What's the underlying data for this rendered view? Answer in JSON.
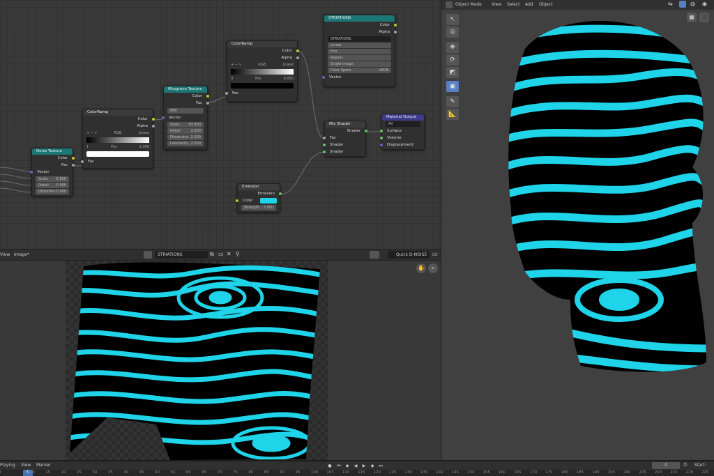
{
  "node_editor": {
    "noise": {
      "title": "Noise Texture",
      "out_color": "Color",
      "out_fac": "Fac",
      "in_vector": "Vector",
      "fields": [
        {
          "label": "Scale",
          "value": "6.800"
        },
        {
          "label": "Detail",
          "value": "0.000"
        },
        {
          "label": "Distortion",
          "value": "0.000"
        }
      ]
    },
    "ramp1": {
      "title": "ColorRamp",
      "out_color": "Color",
      "out_alpha": "Alpha",
      "controls": [
        "+",
        "−",
        "∨"
      ],
      "mode": "RGB",
      "interp": "Linear",
      "index": "1",
      "pos_label": "Pos",
      "pos_value": "1.000",
      "in_fac": "Fac",
      "swatch_color": "#ffffff"
    },
    "musgrave": {
      "title": "Musgrave Texture",
      "out_color": "Color",
      "out_fac": "Fac",
      "type": "fBM",
      "in_vector": "Vector",
      "fields": [
        {
          "label": "Scale",
          "value": "63.800"
        },
        {
          "label": "Detail",
          "value": "2.000"
        },
        {
          "label": "Dimension",
          "value": "2.000"
        },
        {
          "label": "Lacunarity",
          "value": "2.000"
        }
      ]
    },
    "ramp2": {
      "title": "ColorRamp",
      "out_color": "Color",
      "out_alpha": "Alpha",
      "controls": [
        "+",
        "−",
        "∨"
      ],
      "mode": "RGB",
      "interp": "Linear",
      "index": "0",
      "pos_label": "Pos",
      "pos_value": "0.000",
      "in_fac": "Fac",
      "swatch_color": "#000000"
    },
    "image": {
      "title": "STRIATIONS",
      "out_color": "Color",
      "out_alpha": "Alpha",
      "image_name": "STRIATIONS",
      "options": [
        "Linear",
        "Flat",
        "Repeat",
        "Single Image"
      ],
      "colorspace_label": "Color Space",
      "colorspace_value": "sRGB",
      "in_vector": "Vector"
    },
    "mix": {
      "title": "Mix Shader",
      "out_shader": "Shader",
      "in_fac": "Fac",
      "in_shader1": "Shader",
      "in_shader2": "Shader"
    },
    "output": {
      "title": "Material Output",
      "target": "All",
      "in_surface": "Surface",
      "in_volume": "Volume",
      "in_displacement": "Displacement"
    },
    "emission": {
      "title": "Emission",
      "out_emission": "Emission",
      "in_color": "Color",
      "color": "#1fd3e8",
      "strength_label": "Strength",
      "strength_value": "7.600"
    }
  },
  "image_editor": {
    "menu_view": "View",
    "menu_image": "Image*",
    "image_name": "STRIATIONS",
    "denoise": "Quick D-NOISE"
  },
  "viewport": {
    "mode": "Object Mode",
    "menu": [
      "View",
      "Select",
      "Add",
      "Object"
    ]
  },
  "timeline": {
    "menu": [
      "Playing",
      "View",
      "Marker"
    ],
    "current_frame": "0",
    "start_label": "Start:",
    "ruler": [
      "0",
      "5",
      "10",
      "15",
      "20",
      "25",
      "30",
      "35",
      "40",
      "45",
      "50",
      "55",
      "60",
      "65",
      "70",
      "75",
      "80",
      "85",
      "90",
      "95",
      "100",
      "105",
      "110",
      "115",
      "120",
      "125",
      "130",
      "135",
      "140",
      "145",
      "150",
      "155",
      "160",
      "165",
      "170",
      "175",
      "180",
      "185",
      "190",
      "195",
      "200",
      "205",
      "210",
      "215",
      "220",
      "225"
    ]
  },
  "colors": {
    "cyan": "#1fd3e8",
    "texture_header": "#1d7777",
    "output_header": "#3b3b8a",
    "active_tool": "#5680c2"
  }
}
